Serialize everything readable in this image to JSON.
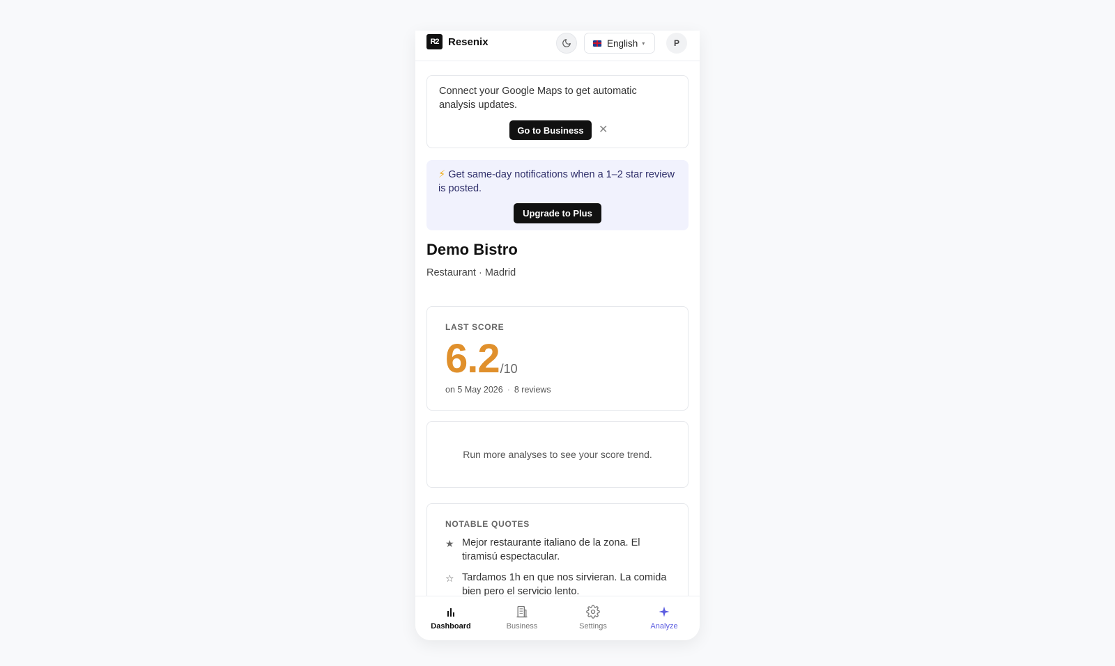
{
  "header": {
    "brand_logo_text": "R2",
    "brand_name": "Resenix",
    "language": "English",
    "avatar_initial": "P"
  },
  "connect_banner": {
    "text": "Connect your Google Maps to get automatic analysis updates.",
    "button_label": "Go to Business",
    "close_symbol": "✕"
  },
  "upgrade_banner": {
    "icon": "⚡",
    "text": "Get same-day notifications when a 1–2 star review is posted.",
    "button_label": "Upgrade to Plus"
  },
  "business": {
    "name": "Demo Bistro",
    "subtitle": "Restaurant · Madrid"
  },
  "score": {
    "label": "LAST SCORE",
    "value": "6.2",
    "max": "/10",
    "date": "on 5 May 2026",
    "separator": "·",
    "reviews": "8 reviews",
    "color": "#e0902c"
  },
  "trend": {
    "text": "Run more analyses to see your score trend."
  },
  "quotes": {
    "label": "NOTABLE QUOTES",
    "items": [
      {
        "icon": "star-filled-icon",
        "glyph": "★",
        "text": "Mejor restaurante italiano de la zona. El tiramisú espectacular."
      },
      {
        "icon": "star-outline-icon",
        "glyph": "☆",
        "text": "Tardamos 1h en que nos sirvieran. La comida bien pero el servicio lento."
      }
    ]
  },
  "nav": {
    "items": [
      {
        "label": "Dashboard",
        "icon": "bar-chart-icon"
      },
      {
        "label": "Business",
        "icon": "building-icon"
      },
      {
        "label": "Settings",
        "icon": "gear-icon"
      },
      {
        "label": "Analyze",
        "icon": "sparkle-icon"
      }
    ],
    "accent_color": "#5b5ce0"
  }
}
